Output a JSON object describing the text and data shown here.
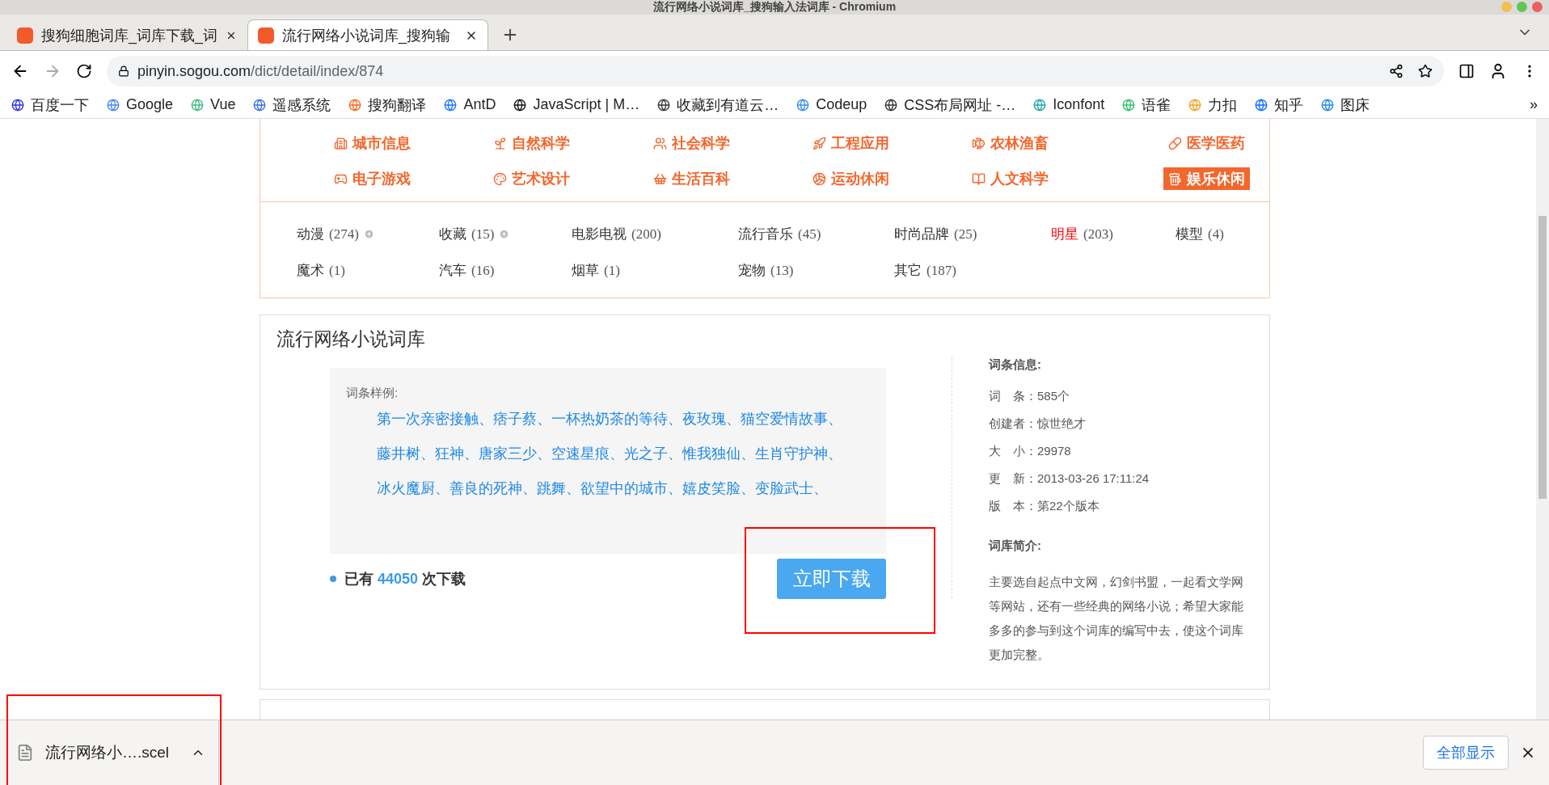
{
  "window": {
    "title": "流行网络小说词库_搜狗输入法词库 - Chromium"
  },
  "tabs": [
    {
      "label": "搜狗细胞词库_词库下载_词",
      "selected": false
    },
    {
      "label": "流行网络小说词库_搜狗输",
      "selected": true
    }
  ],
  "address": {
    "host": "pinyin.sogou.com",
    "path": "/dict/detail/index/874"
  },
  "bookmarks": [
    "百度一下",
    "Google",
    "Vue",
    "遥感系统",
    "搜狗翻译",
    "AntD",
    "JavaScript | M…",
    "收藏到有道云…",
    "Codeup",
    "CSS布局网址 -…",
    "Iconfont",
    "语雀",
    "力扣",
    "知乎",
    "图床"
  ],
  "bookmarks_more": "»",
  "categories": [
    {
      "label": "城市信息",
      "selected": false
    },
    {
      "label": "自然科学",
      "selected": false
    },
    {
      "label": "社会科学",
      "selected": false
    },
    {
      "label": "工程应用",
      "selected": false
    },
    {
      "label": "农林渔畜",
      "selected": false
    },
    {
      "label": "医学医药",
      "selected": false
    },
    {
      "label": "电子游戏",
      "selected": false
    },
    {
      "label": "艺术设计",
      "selected": false
    },
    {
      "label": "生活百科",
      "selected": false
    },
    {
      "label": "运动休闲",
      "selected": false
    },
    {
      "label": "人文科学",
      "selected": false
    },
    {
      "label": "娱乐休闲",
      "selected": true
    }
  ],
  "subcategories": [
    {
      "name": "动漫",
      "count": "(274)",
      "selected": false,
      "expandable": true
    },
    {
      "name": "收藏",
      "count": "(15)",
      "selected": false,
      "expandable": true
    },
    {
      "name": "电影电视",
      "count": "(200)",
      "selected": false,
      "expandable": false
    },
    {
      "name": "流行音乐",
      "count": "(45)",
      "selected": false,
      "expandable": false
    },
    {
      "name": "时尚品牌",
      "count": "(25)",
      "selected": false,
      "expandable": false
    },
    {
      "name": "明星",
      "count": "(203)",
      "selected": true,
      "expandable": false
    },
    {
      "name": "模型",
      "count": "(4)",
      "selected": false,
      "expandable": false
    },
    {
      "name": "魔术",
      "count": "(1)",
      "selected": false,
      "expandable": false
    },
    {
      "name": "汽车",
      "count": "(16)",
      "selected": false,
      "expandable": false
    },
    {
      "name": "烟草",
      "count": "(1)",
      "selected": false,
      "expandable": false
    },
    {
      "name": "宠物",
      "count": "(13)",
      "selected": false,
      "expandable": false
    },
    {
      "name": "其它",
      "count": "(187)",
      "selected": false,
      "expandable": false
    }
  ],
  "dict": {
    "title": "流行网络小说词库",
    "sample_label": "词条样例:",
    "sample_lines": [
      "第一次亲密接触、痞子蔡、一杯热奶茶的等待、夜玫瑰、猫空爱情故事、",
      "藤井树、狂神、唐家三少、空速星痕、光之子、惟我独仙、生肖守护神、",
      "冰火魔厨、善良的死神、跳舞、欲望中的城市、嬉皮笑脸、变脸武士、"
    ],
    "downloads_prefix": "已有",
    "downloads_count": "44050",
    "downloads_suffix": "次下载",
    "download_button": "立即下载",
    "download_highlighted": true,
    "info_title": "词条信息:",
    "info": [
      {
        "label": "词　条：",
        "value": "585个"
      },
      {
        "label": "创建者：",
        "value": "惊世绝才"
      },
      {
        "label": "大　小：",
        "value": "29978"
      },
      {
        "label": "更　新：",
        "value": "2013-03-26 17:11:24"
      },
      {
        "label": "版　本：",
        "value": "第22个版本"
      }
    ],
    "intro_title": "词库简介:",
    "intro": "主要选自起点中文网，幻剑书盟，一起看文学网等网站，还有一些经典的网络小说；希望大家能多多的参与到这个词库的编写中去，使这个词库更加完整。"
  },
  "download_bar": {
    "file": "流行网络小….scel",
    "highlighted": true,
    "show_all": "全部显示"
  }
}
